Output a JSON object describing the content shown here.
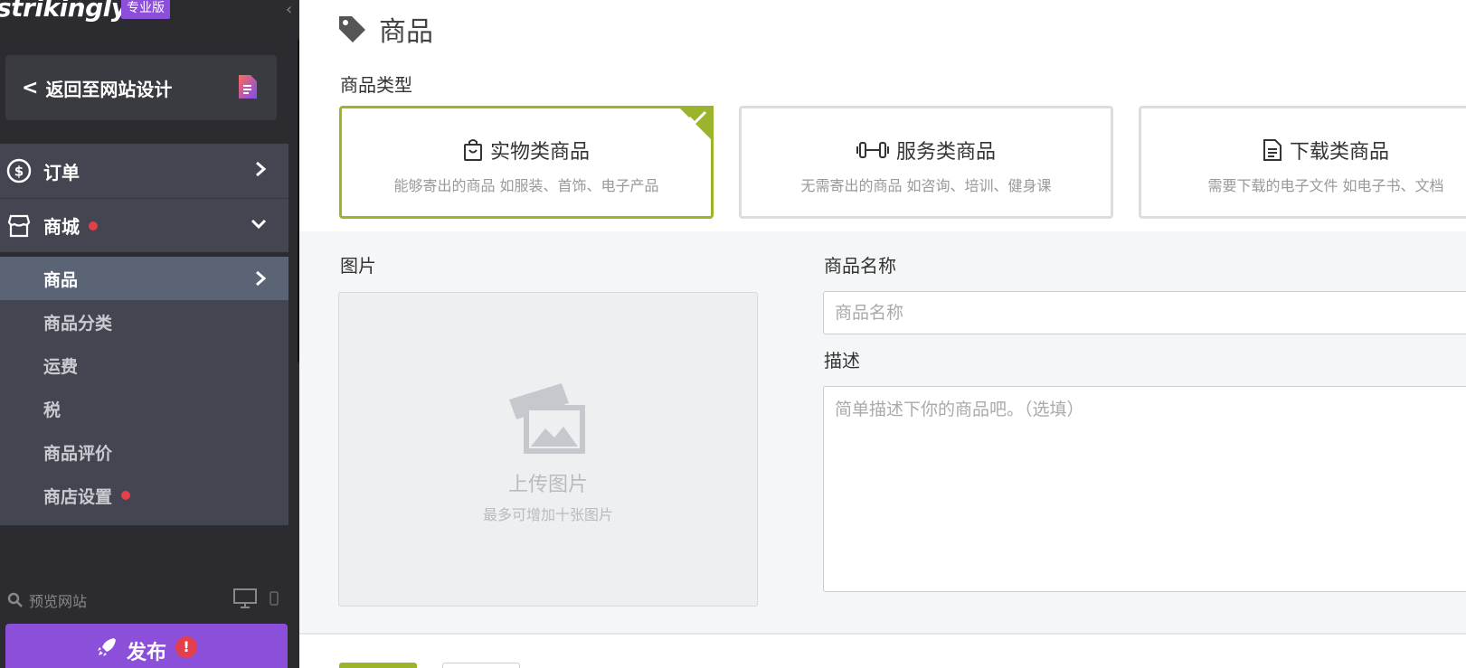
{
  "sidebar": {
    "logo": "strikingly",
    "badge": "专业版",
    "back_label": "返回至网站设计",
    "nav": [
      {
        "label": "订单"
      },
      {
        "label": "商城"
      }
    ],
    "sub_items": [
      {
        "label": "商品"
      },
      {
        "label": "商品分类"
      },
      {
        "label": "运费"
      },
      {
        "label": "税"
      },
      {
        "label": "商品评价"
      },
      {
        "label": "商店设置"
      }
    ],
    "preview_label": "预览网站",
    "publish_label": "发布",
    "publish_warning": "!"
  },
  "main": {
    "title": "商品",
    "type_label": "商品类型",
    "types": [
      {
        "title": "实物类商品",
        "desc": "能够寄出的商品 如服装、首饰、电子产品",
        "icon": "shopping-bag-icon",
        "selected": true
      },
      {
        "title": "服务类商品",
        "desc": "无需寄出的商品 如咨询、培训、健身课",
        "icon": "dumbbell-icon",
        "selected": false
      },
      {
        "title": "下载类商品",
        "desc": "需要下载的电子文件 如电子书、文档",
        "icon": "document-icon",
        "selected": false
      }
    ],
    "image_label": "图片",
    "upload_title": "上传图片",
    "upload_hint": "最多可增加十张图片",
    "name_label": "商品名称",
    "name_placeholder": "商品名称",
    "desc_label": "描述",
    "desc_placeholder": "简单描述下你的商品吧。（选填）"
  },
  "colors": {
    "sidebar_bg": "#2c2c30",
    "nav_bg": "#434650",
    "active_bg": "#5b6474",
    "brand_purple": "#8b4fd9",
    "selected_green": "#9ab52c",
    "alert_red": "#e53e4d"
  }
}
